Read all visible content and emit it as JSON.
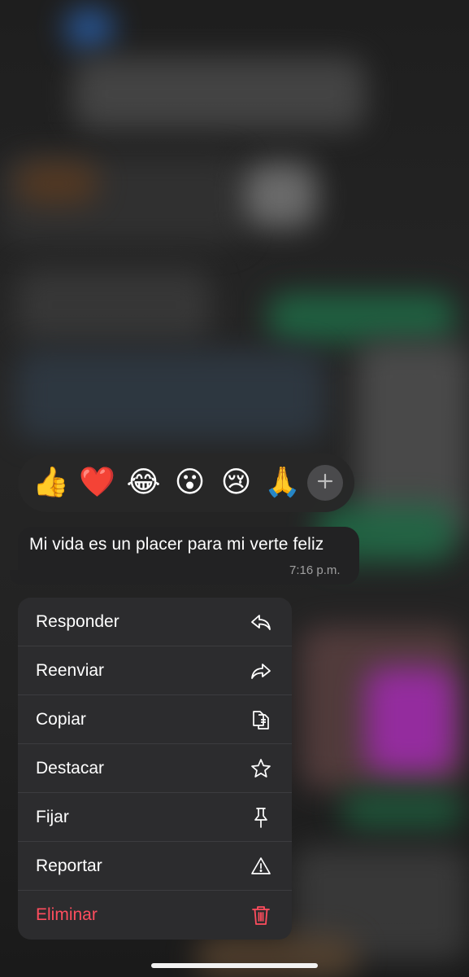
{
  "reactions": {
    "emojis": [
      "👍",
      "❤️",
      "😂",
      "😮",
      "😢",
      "🙏"
    ],
    "more_icon": "plus-icon"
  },
  "message": {
    "text": "Mi vida es un placer para mi verte feliz",
    "time": "7:16 p.m."
  },
  "menu": {
    "items": [
      {
        "label": "Responder",
        "icon": "reply-icon"
      },
      {
        "label": "Reenviar",
        "icon": "forward-icon"
      },
      {
        "label": "Copiar",
        "icon": "copy-icon"
      },
      {
        "label": "Destacar",
        "icon": "star-icon"
      },
      {
        "label": "Fijar",
        "icon": "pin-icon"
      },
      {
        "label": "Reportar",
        "icon": "warning-icon"
      },
      {
        "label": "Eliminar",
        "icon": "trash-icon"
      }
    ]
  },
  "colors": {
    "danger": "#ff4d5e",
    "menu_bg": "#2c2c2e",
    "bubble_bg": "#222223"
  }
}
